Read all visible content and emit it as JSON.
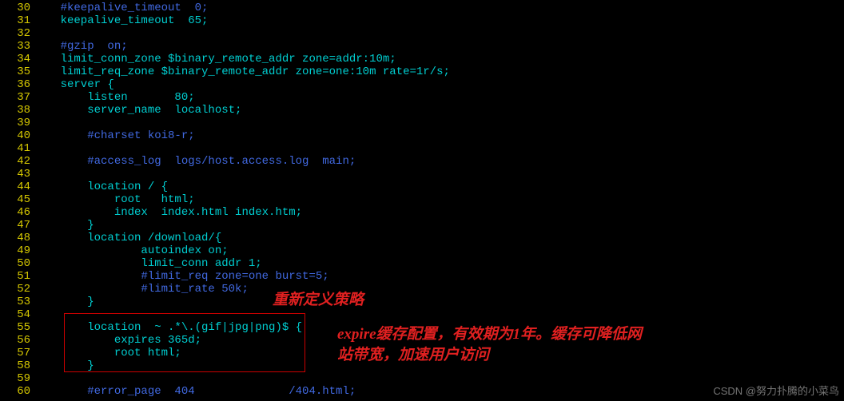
{
  "lines": [
    {
      "n": 30,
      "seg": [
        {
          "c": "comment",
          "t": "    #keepalive_timeout  0;"
        }
      ]
    },
    {
      "n": 31,
      "seg": [
        {
          "c": "plain",
          "t": "    keepalive_timeout  65;"
        }
      ]
    },
    {
      "n": 32,
      "seg": [
        {
          "c": "plain",
          "t": " "
        }
      ]
    },
    {
      "n": 33,
      "seg": [
        {
          "c": "comment",
          "t": "    #gzip  on;"
        }
      ]
    },
    {
      "n": 34,
      "seg": [
        {
          "c": "plain",
          "t": "    limit_conn_zone $binary_remote_addr zone=addr:10m;"
        }
      ]
    },
    {
      "n": 35,
      "seg": [
        {
          "c": "plain",
          "t": "    limit_req_zone $binary_remote_addr zone=one:10m rate=1r/s;"
        }
      ]
    },
    {
      "n": 36,
      "seg": [
        {
          "c": "plain",
          "t": "    server {"
        }
      ]
    },
    {
      "n": 37,
      "seg": [
        {
          "c": "plain",
          "t": "        listen       80;"
        }
      ]
    },
    {
      "n": 38,
      "seg": [
        {
          "c": "plain",
          "t": "        server_name  localhost;"
        }
      ]
    },
    {
      "n": 39,
      "seg": [
        {
          "c": "plain",
          "t": " "
        }
      ]
    },
    {
      "n": 40,
      "seg": [
        {
          "c": "comment",
          "t": "        #charset koi8-r;"
        }
      ]
    },
    {
      "n": 41,
      "seg": [
        {
          "c": "plain",
          "t": " "
        }
      ]
    },
    {
      "n": 42,
      "seg": [
        {
          "c": "comment",
          "t": "        #access_log  logs/host.access.log  main;"
        }
      ]
    },
    {
      "n": 43,
      "seg": [
        {
          "c": "plain",
          "t": " "
        }
      ]
    },
    {
      "n": 44,
      "seg": [
        {
          "c": "plain",
          "t": "        location / {"
        }
      ]
    },
    {
      "n": 45,
      "seg": [
        {
          "c": "plain",
          "t": "            root   html;"
        }
      ]
    },
    {
      "n": 46,
      "seg": [
        {
          "c": "plain",
          "t": "            index  index.html index.htm;"
        }
      ]
    },
    {
      "n": 47,
      "seg": [
        {
          "c": "plain",
          "t": "        }"
        }
      ]
    },
    {
      "n": 48,
      "seg": [
        {
          "c": "plain",
          "t": "        location /download/{"
        }
      ]
    },
    {
      "n": 49,
      "seg": [
        {
          "c": "plain",
          "t": "                autoindex on;"
        }
      ]
    },
    {
      "n": 50,
      "seg": [
        {
          "c": "plain",
          "t": "                limit_conn addr 1;"
        }
      ]
    },
    {
      "n": 51,
      "seg": [
        {
          "c": "comment",
          "t": "                #limit_req zone=one burst=5;"
        }
      ]
    },
    {
      "n": 52,
      "seg": [
        {
          "c": "comment",
          "t": "                #limit_rate 50k;"
        }
      ]
    },
    {
      "n": 53,
      "seg": [
        {
          "c": "plain",
          "t": "        }"
        }
      ]
    },
    {
      "n": 54,
      "seg": [
        {
          "c": "plain",
          "t": " "
        }
      ]
    },
    {
      "n": 55,
      "seg": [
        {
          "c": "plain",
          "t": "        location  ~ .*\\.(gif|jpg|png)$ {"
        }
      ]
    },
    {
      "n": 56,
      "seg": [
        {
          "c": "plain",
          "t": "            expires 365d;"
        }
      ]
    },
    {
      "n": 57,
      "seg": [
        {
          "c": "plain",
          "t": "            root html;"
        }
      ]
    },
    {
      "n": 58,
      "seg": [
        {
          "c": "plain",
          "t": "        }"
        }
      ]
    },
    {
      "n": 59,
      "seg": [
        {
          "c": "plain",
          "t": " "
        }
      ]
    },
    {
      "n": 60,
      "seg": [
        {
          "c": "comment",
          "t": "        #error_page  404              /404.html;"
        }
      ]
    }
  ],
  "annotations": {
    "redefine": "重新定义策略",
    "expire_l1": "expire缓存配置，有效期为1年。缓存可降低网",
    "expire_l2": "站带宽，加速用户访问"
  },
  "watermark": "CSDN @努力扑腾的小菜鸟"
}
